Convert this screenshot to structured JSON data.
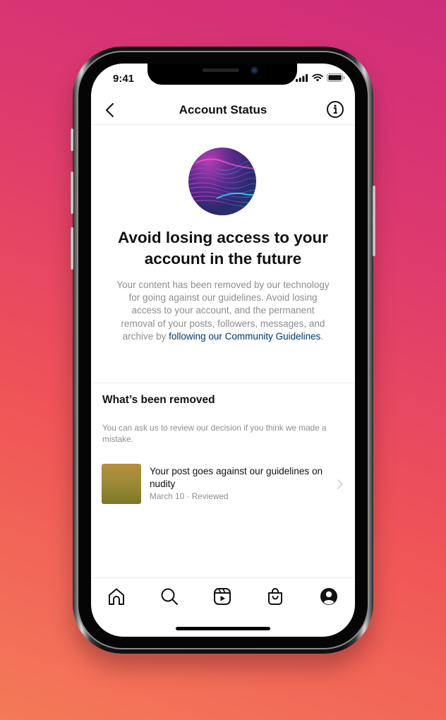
{
  "status_bar": {
    "time": "9:41",
    "icons": [
      "cellular-signal-icon",
      "wifi-icon",
      "battery-icon"
    ]
  },
  "header": {
    "title": "Account Status",
    "back_icon": "chevron-left-icon",
    "info_icon": "info-circle-icon"
  },
  "hero": {
    "image": "abstract-wave-illustration",
    "headline": "Avoid losing access to your account in the future",
    "description_text": "Your content has been removed by our technology for going against our guidelines. Avoid losing access to your account, and the permanent removal of your posts, followers, messages, and archive by ",
    "description_link": "following our Community Guidelines",
    "description_end": "."
  },
  "removed_section": {
    "title": "What’s been removed",
    "subtitle": "You can ask us to review our decision if you think we made a mistake.",
    "items": [
      {
        "title": "Your post goes against our guidelines on nudity",
        "meta": "March 10 · Reviewed",
        "icon": "chevron-right-icon"
      }
    ]
  },
  "tab_bar": {
    "items": [
      {
        "name": "home",
        "icon": "home-icon"
      },
      {
        "name": "search",
        "icon": "search-icon"
      },
      {
        "name": "reels",
        "icon": "reels-icon"
      },
      {
        "name": "shop",
        "icon": "shopping-bag-icon"
      },
      {
        "name": "profile",
        "icon": "profile-icon"
      }
    ]
  },
  "colors": {
    "link": "#00376b",
    "secondary_text": "#8e8e8e",
    "primary_text": "#111111",
    "divider": "#ececec",
    "background_gradient": [
      "#cf2c7c",
      "#ef5357",
      "#f47a58"
    ]
  }
}
